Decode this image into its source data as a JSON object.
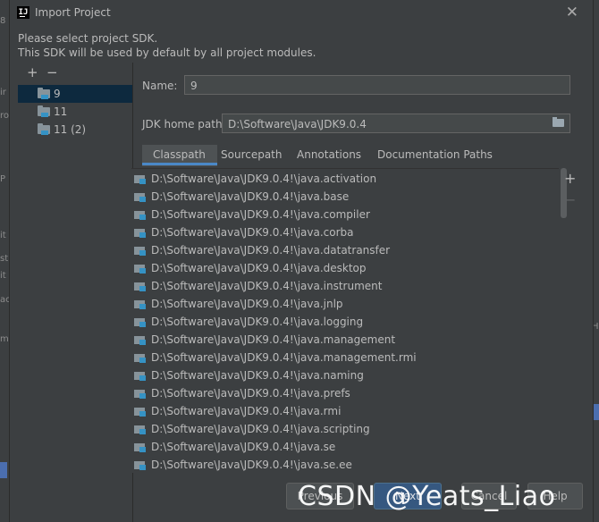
{
  "window": {
    "title": "Import Project",
    "app_icon_text": "IJ"
  },
  "description": {
    "line1": "Please select project SDK.",
    "line2": "This SDK will be used by default by all project modules."
  },
  "sdk_list": {
    "add": "+",
    "remove": "−",
    "items": [
      {
        "label": "9",
        "selected": true
      },
      {
        "label": "11",
        "selected": false
      },
      {
        "label": "11 (2)",
        "selected": false
      }
    ]
  },
  "form": {
    "name_label": "Name:",
    "name_value": "9",
    "jdk_label": "JDK home path:",
    "jdk_value": "D:\\Software\\Java\\JDK9.0.4"
  },
  "tabs": [
    {
      "label": "Classpath",
      "active": true
    },
    {
      "label": "Sourcepath",
      "active": false
    },
    {
      "label": "Annotations",
      "active": false
    },
    {
      "label": "Documentation Paths",
      "active": false
    }
  ],
  "classpath": [
    "D:\\Software\\Java\\JDK9.0.4!\\java.activation",
    "D:\\Software\\Java\\JDK9.0.4!\\java.base",
    "D:\\Software\\Java\\JDK9.0.4!\\java.compiler",
    "D:\\Software\\Java\\JDK9.0.4!\\java.corba",
    "D:\\Software\\Java\\JDK9.0.4!\\java.datatransfer",
    "D:\\Software\\Java\\JDK9.0.4!\\java.desktop",
    "D:\\Software\\Java\\JDK9.0.4!\\java.instrument",
    "D:\\Software\\Java\\JDK9.0.4!\\java.jnlp",
    "D:\\Software\\Java\\JDK9.0.4!\\java.logging",
    "D:\\Software\\Java\\JDK9.0.4!\\java.management",
    "D:\\Software\\Java\\JDK9.0.4!\\java.management.rmi",
    "D:\\Software\\Java\\JDK9.0.4!\\java.naming",
    "D:\\Software\\Java\\JDK9.0.4!\\java.prefs",
    "D:\\Software\\Java\\JDK9.0.4!\\java.rmi",
    "D:\\Software\\Java\\JDK9.0.4!\\java.scripting",
    "D:\\Software\\Java\\JDK9.0.4!\\java.se",
    "D:\\Software\\Java\\JDK9.0.4!\\java.se.ee"
  ],
  "side_actions": {
    "add": "+",
    "remove": "−"
  },
  "buttons": {
    "previous": "Previous",
    "next": "Next",
    "cancel": "Cancel",
    "help": "Help"
  },
  "watermark": "CSDN @Yeats_Liao",
  "colors": {
    "dialog_bg": "#3c3f41",
    "selection": "#0d293e",
    "accent": "#4a88c7",
    "primary_button": "#365880"
  }
}
